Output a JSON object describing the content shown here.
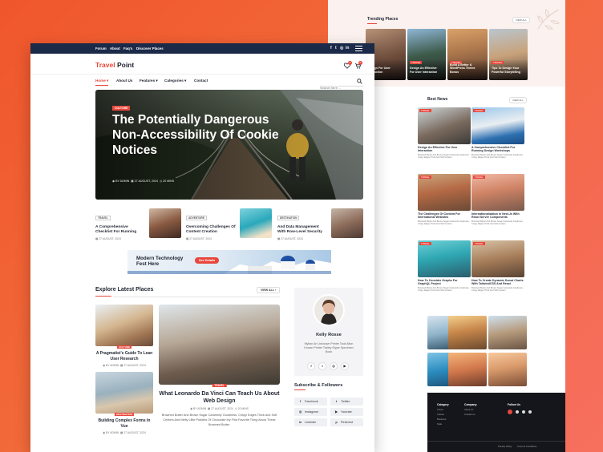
{
  "back_page": {
    "trending_title": "Trending Places",
    "view_all": "VIEW ALL",
    "trending_cards": [
      {
        "caption": "Design For User Interaction",
        "tag": ""
      },
      {
        "caption": "Design An Effective For User Interaction",
        "tag": "TRAVEL"
      },
      {
        "caption": "Build A Better & WordPress Theme Bonus",
        "tag": "TRAVEL"
      },
      {
        "caption": "Tips To Design Your Powerful Storytelling",
        "tag": "TRAVEL"
      }
    ],
    "best_news_title": "Best News",
    "best_news_view": "VIEW ALL",
    "news": [
      {
        "title": "Design An Effective For User Interaction",
        "desc": "Browned Butter And Brown Sugar Caramelly Goodness, Crispy Edges Thick And Soft Centers",
        "tag": "TRAVEL"
      },
      {
        "title": "A Comprehensive Checklist For Running Design Workshops",
        "desc": "Browned Butter And Brown Sugar Caramelly Goodness, Crispy Edges Thick And Soft Centers",
        "tag": "TRAVEL"
      },
      {
        "title": "The Challenges Of Content For International Websites",
        "desc": "Browned Butter And Brown Sugar Caramelly Goodness, Crispy Edges Thick And Soft Centers",
        "tag": "TRAVEL"
      },
      {
        "title": "Internationalization In Next.Js With React Server Components",
        "desc": "Browned Butter And Brown Sugar Caramelly Goodness, Crispy Edges Thick And Soft Centers",
        "tag": "TRAVEL"
      },
      {
        "title": "How To Consider Graphs For GraphQL Project",
        "desc": "Browned Butter And Brown Sugar Caramelly Goodness, Crispy Edges Thick And Soft Centers",
        "tag": "TRAVEL"
      },
      {
        "title": "How To Create Dynamic Donut Charts With TailwindCSS And React",
        "desc": "Browned Butter And Brown Sugar Caramelly Goodness, Crispy Edges Thick And Soft Centers",
        "tag": "TRAVEL"
      }
    ],
    "footer": {
      "category_title": "Category",
      "category_items": [
        "Travel",
        "Culture",
        "Business",
        "Style"
      ],
      "company_title": "Company",
      "company_items": [
        "About Us",
        "Contact us"
      ],
      "follow_title": "Follow Us",
      "follow_icons": [
        "facebook-icon",
        "twitter-icon",
        "instagram-icon",
        "youtube-icon"
      ],
      "privacy": "Privacy Policy",
      "terms": "Terms & Conditions"
    }
  },
  "topbar": {
    "links": [
      "Forum",
      "About",
      "Faq's",
      "Discover Places"
    ],
    "icons": [
      "f",
      "t",
      "◎",
      "in"
    ]
  },
  "header": {
    "logo_a": "Travel",
    "logo_b": "Point",
    "heart_count": "0",
    "cart_count": "0"
  },
  "nav": {
    "items": [
      "Home",
      "About Us",
      "Features",
      "Categories",
      "Contact"
    ],
    "search_placeholder": "Search here ..."
  },
  "hero": {
    "tag": "CULTURE",
    "title": "The Potentially Dangerous Non-Accessibility Of Cookie Notices",
    "author": "BY ADMIN",
    "date": "27 AUGUST, 2024",
    "read": "20 MINS"
  },
  "mini_posts": [
    {
      "tag": "TRAVEL",
      "title": "A Comprehensive Checklist For Running",
      "date": "27 AUGUST, 2024"
    },
    {
      "tag": "ADVENTURE",
      "title": "Overcoming Challenges Of Content Creation",
      "date": "27 AUGUST, 2024"
    },
    {
      "tag": "DESTINATION",
      "title": "And Data Management With Row-Level Security",
      "date": "27 AUGUST, 2024"
    }
  ],
  "banner": {
    "text": "Modern Technology Fest Here",
    "button": "See Details"
  },
  "explore": {
    "title": "Explore Latest Places",
    "view_all": "VIEW ALL",
    "small_cards": [
      {
        "tag": "CULTURE",
        "title": "A Pragmatist's Guide To Lean User Research",
        "author": "BY ADMIN",
        "date": "27 AUGUST, 2024"
      },
      {
        "tag": "DESTINATION",
        "title": "Building Complex Forms In Vue",
        "author": "BY ADMIN",
        "date": "27 AUGUST, 2024"
      }
    ],
    "featured": {
      "tag": "TRAVEL",
      "title": "What Leonardo Da Vinci Can Teach Us About Web Design",
      "author": "BY ADMIN",
      "date": "27 AUGUST, 2024",
      "read": "20 MINS",
      "desc": "Browned Butter And Brown Sugar Caramelly Goodness, Crispy Edges Thick And Soft Centers And Melty Little Puddles Of Chocolate My First Favorite Thing About These Browned Butter."
    }
  },
  "author": {
    "name": "Kelly Rosse",
    "bio": "Mytian An Unknown Printer Took Alton Known Printer Ttalley Etype Specimen Book"
  },
  "subscribe": {
    "title": "Subscribe & Followers",
    "items": [
      {
        "icon": "f",
        "label": "Facebook"
      },
      {
        "icon": "t",
        "label": "Twitter"
      },
      {
        "icon": "◎",
        "label": "Instagram"
      },
      {
        "icon": "▶",
        "label": "Youtube"
      },
      {
        "icon": "in",
        "label": "Linkedin"
      },
      {
        "icon": "p",
        "label": "Pinterest"
      }
    ]
  },
  "colors": {
    "accent": "#e8473b",
    "topbar": "#1b2a49",
    "background": "#f0562c"
  }
}
